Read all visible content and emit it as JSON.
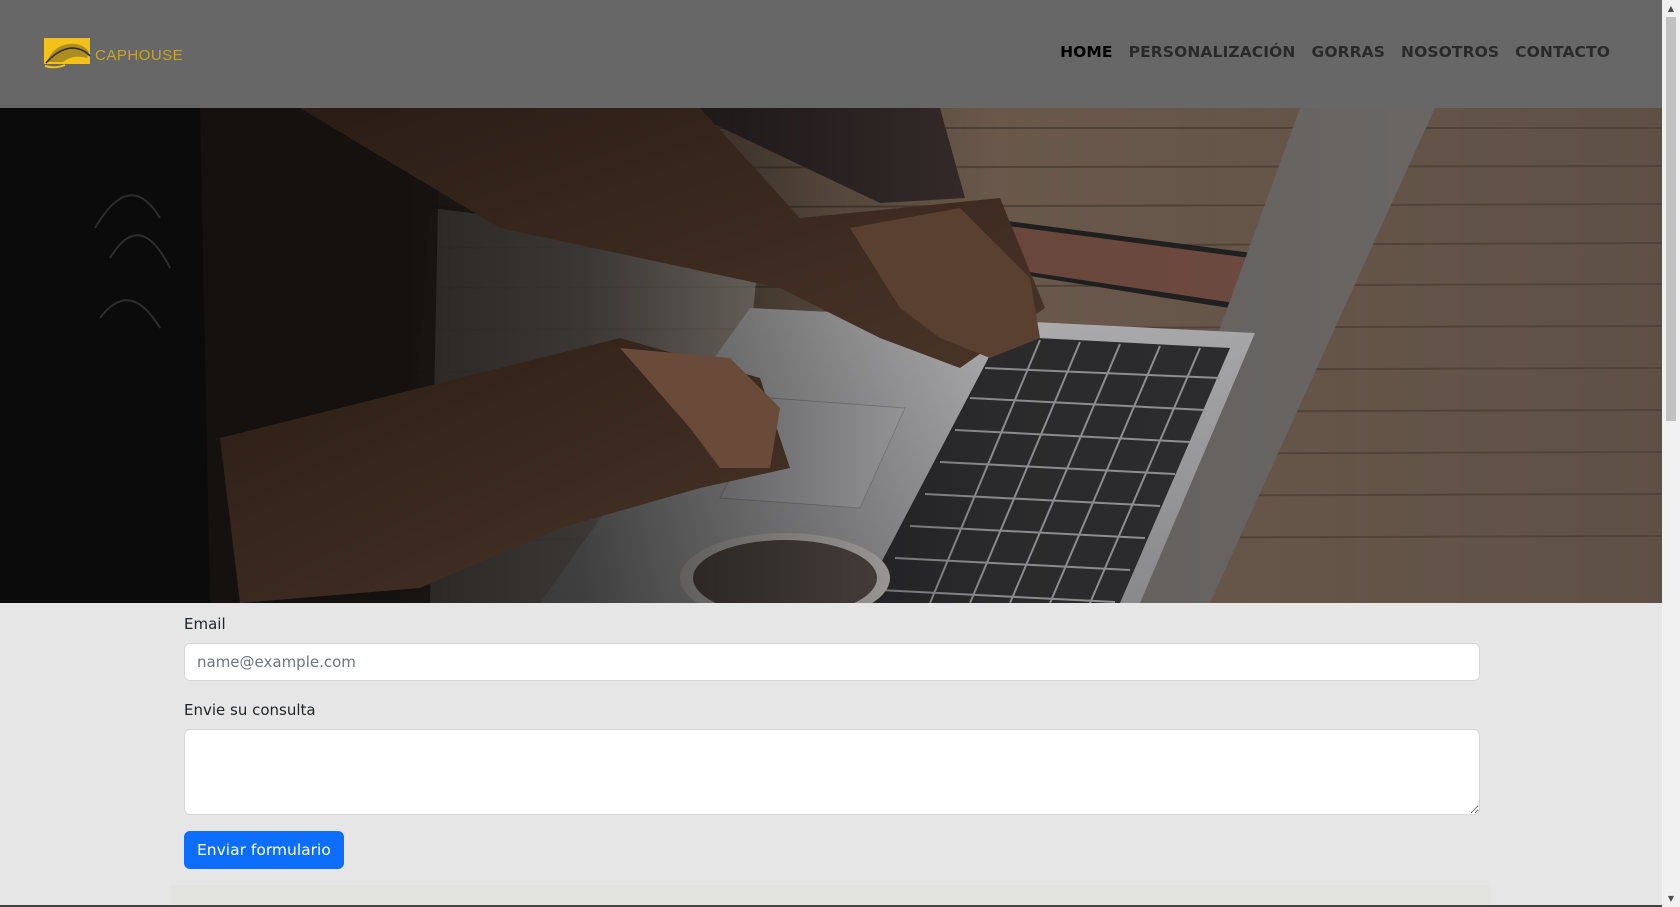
{
  "brand": {
    "name": "CAPHOUSE",
    "logo_icon": "cap-logo-icon",
    "accent_color": "#f2c21b"
  },
  "nav": {
    "items": [
      {
        "label": "HOME",
        "active": true
      },
      {
        "label": "PERSONALIZACIÓN",
        "active": false
      },
      {
        "label": "GORRAS",
        "active": false
      },
      {
        "label": "NOSOTROS",
        "active": false
      },
      {
        "label": "CONTACTO",
        "active": false
      }
    ]
  },
  "hero": {
    "image": "person typing on laptop at wooden desk"
  },
  "form": {
    "email_label": "Email",
    "email_placeholder": "name@example.com",
    "email_value": "",
    "message_label": "Envie su consulta",
    "message_value": "",
    "submit_label": "Enviar formulario"
  },
  "colors": {
    "header_bg": "#676767",
    "page_bg": "#e7e6e7",
    "button_bg": "#0d6efd"
  }
}
